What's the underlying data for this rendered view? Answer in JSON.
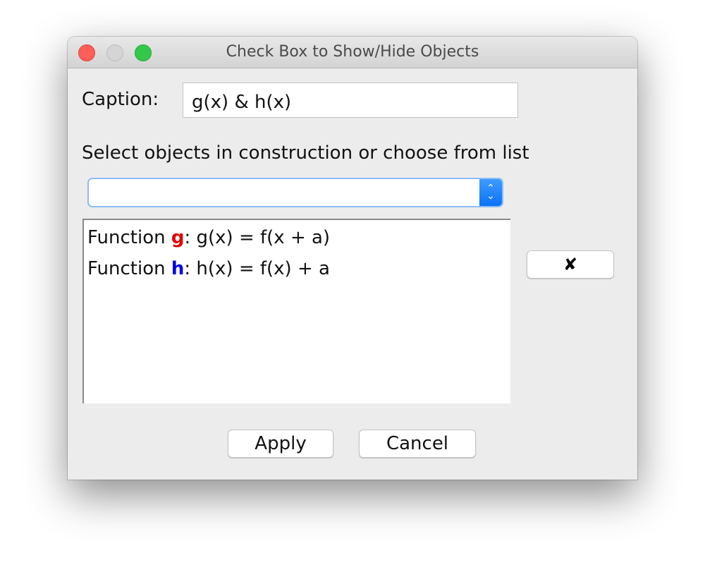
{
  "window": {
    "title": "Check Box to Show/Hide Objects",
    "controls": [
      "close",
      "minimize",
      "zoom"
    ]
  },
  "caption": {
    "label": "Caption:",
    "value": "g(x) & h(x)"
  },
  "instruction": "Select objects in construction or choose from list",
  "object_dropdown": {
    "selected": "",
    "arrow_icon": "up-down-chevrons-icon"
  },
  "object_list": {
    "items": [
      {
        "prefix": "Function ",
        "name": "g",
        "name_color": "#e00000",
        "definition": ": g(x) = f(x + a)"
      },
      {
        "prefix": "Function ",
        "name": "h",
        "name_color": "#0000e6",
        "definition": ": h(x) = f(x) + a"
      }
    ]
  },
  "remove_button": {
    "label": "✘",
    "icon": "x-mark-icon"
  },
  "buttons": {
    "apply": "Apply",
    "cancel": "Cancel"
  }
}
